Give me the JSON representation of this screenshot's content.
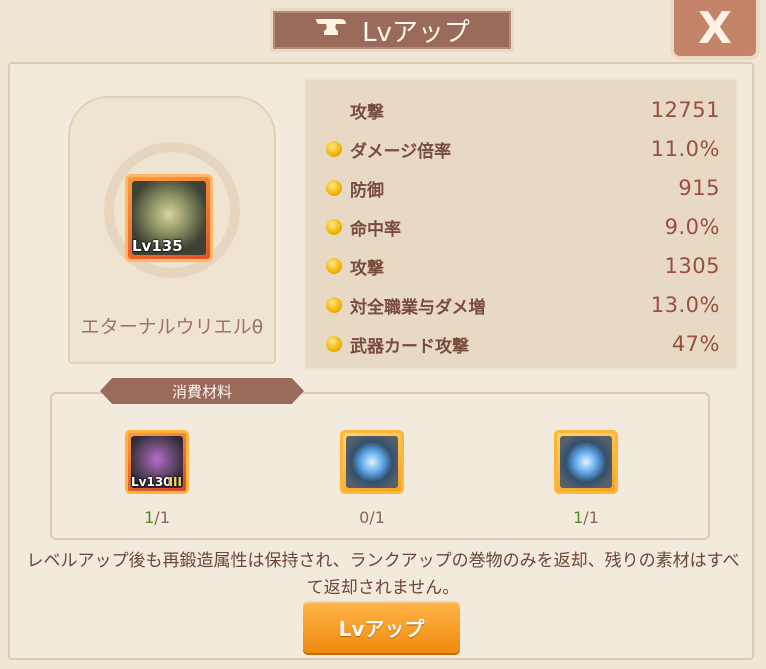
{
  "header": {
    "title": "Lvアップ",
    "close_label": "X"
  },
  "equipment": {
    "name": "エターナルウリエルθ",
    "level": "Lv135"
  },
  "stats": [
    {
      "label": "攻撃",
      "value": "12751",
      "bullet": false
    },
    {
      "label": "ダメージ倍率",
      "value": "11.0%",
      "bullet": true
    },
    {
      "label": "防御",
      "value": "915",
      "bullet": true
    },
    {
      "label": "命中率",
      "value": "9.0%",
      "bullet": true
    },
    {
      "label": "攻撃",
      "value": "1305",
      "bullet": true
    },
    {
      "label": "対全職業与ダメ増",
      "value": "13.0%",
      "bullet": true
    },
    {
      "label": "武器カード攻撃",
      "value": "47%",
      "bullet": true
    }
  ],
  "materials": {
    "title": "消費材料",
    "items": [
      {
        "icon": "weapon-icon",
        "level": "Lv130",
        "tier": "III",
        "have": "1",
        "need": "1"
      },
      {
        "icon": "blue-scroll-icon",
        "have": "0",
        "need": "1"
      },
      {
        "icon": "gold-scroll-icon",
        "have": "1",
        "need": "1"
      }
    ]
  },
  "note": "レベルアップ後も再鍛造属性は保持され、ランクアップの巻物のみを返却、残りの素材はすべて返却されません。",
  "action": {
    "button_label": "Lvアップ"
  }
}
